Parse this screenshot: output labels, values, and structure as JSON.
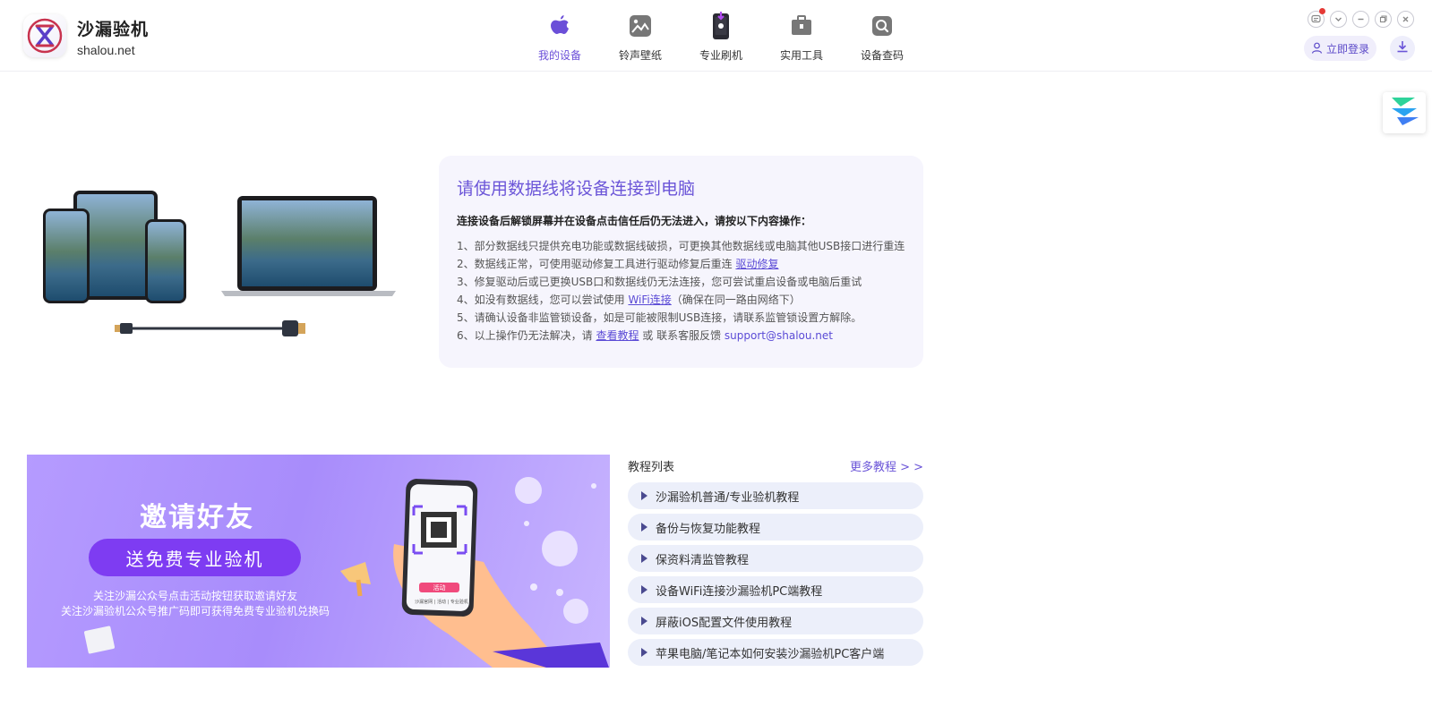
{
  "app": {
    "name": "沙漏验机",
    "domain": "shalou.net"
  },
  "nav": [
    {
      "label": "我的设备",
      "icon": "apple-icon",
      "active": true
    },
    {
      "label": "铃声壁纸",
      "icon": "wallpaper-icon"
    },
    {
      "label": "专业刷机",
      "icon": "flash-phone-icon"
    },
    {
      "label": "实用工具",
      "icon": "toolbox-icon"
    },
    {
      "label": "设备查码",
      "icon": "search-device-icon"
    }
  ],
  "header": {
    "login_label": "立即登录"
  },
  "info": {
    "title": "请使用数据线将设备连接到电脑",
    "subtitle": "连接设备后解锁屏幕并在设备点击信任后仍无法进入，请按以下内容操作：",
    "line1": "1、部分数据线只提供充电功能或数据线破损，可更换其他数据线或电脑其他USB接口进行重连",
    "line2_text": "2、数据线正常，可使用驱动修复工具进行驱动修复后重连 ",
    "line2_link": "驱动修复",
    "line3": "3、修复驱动后或已更换USB口和数据线仍无法连接，您可尝试重启设备或电脑后重试",
    "line4_text": "4、如没有数据线，您可以尝试使用 ",
    "line4_link": "WiFi连接",
    "line4_tail": "（确保在同一路由网络下）",
    "line5": "5、请确认设备非监管锁设备，如是可能被限制USB连接，请联系监管锁设置方解除。",
    "line6_text": "6、以上操作仍无法解决，请 ",
    "line6_link": "查看教程",
    "line6_mid": " 或 联系客服反馈 ",
    "line6_email": "support@shalou.net"
  },
  "banner": {
    "title": "邀请好友",
    "pill": "送免费专业验机",
    "line1": "关注沙漏公众号点击活动按钮获取邀请好友",
    "line2": "关注沙漏验机公众号推广码即可获得免费专业验机兑换码",
    "phone_button": "活动",
    "phone_tabs": "沙漏官网 | 活动 | 专业验机"
  },
  "tutorials": {
    "title": "教程列表",
    "more": "更多教程 > >",
    "items": [
      "沙漏验机普通/专业验机教程",
      "备份与恢复功能教程",
      "保资料清监管教程",
      "设备WiFi连接沙漏验机PC端教程",
      "屏蔽iOS配置文件使用教程",
      "苹果电脑/笔记本如何安装沙漏验机PC客户端"
    ]
  },
  "colors": {
    "accent": "#6b55d8",
    "card_bg": "#f6f5fd",
    "tut_bg": "#eceffa",
    "banner_purple": "#7e3cf2"
  }
}
